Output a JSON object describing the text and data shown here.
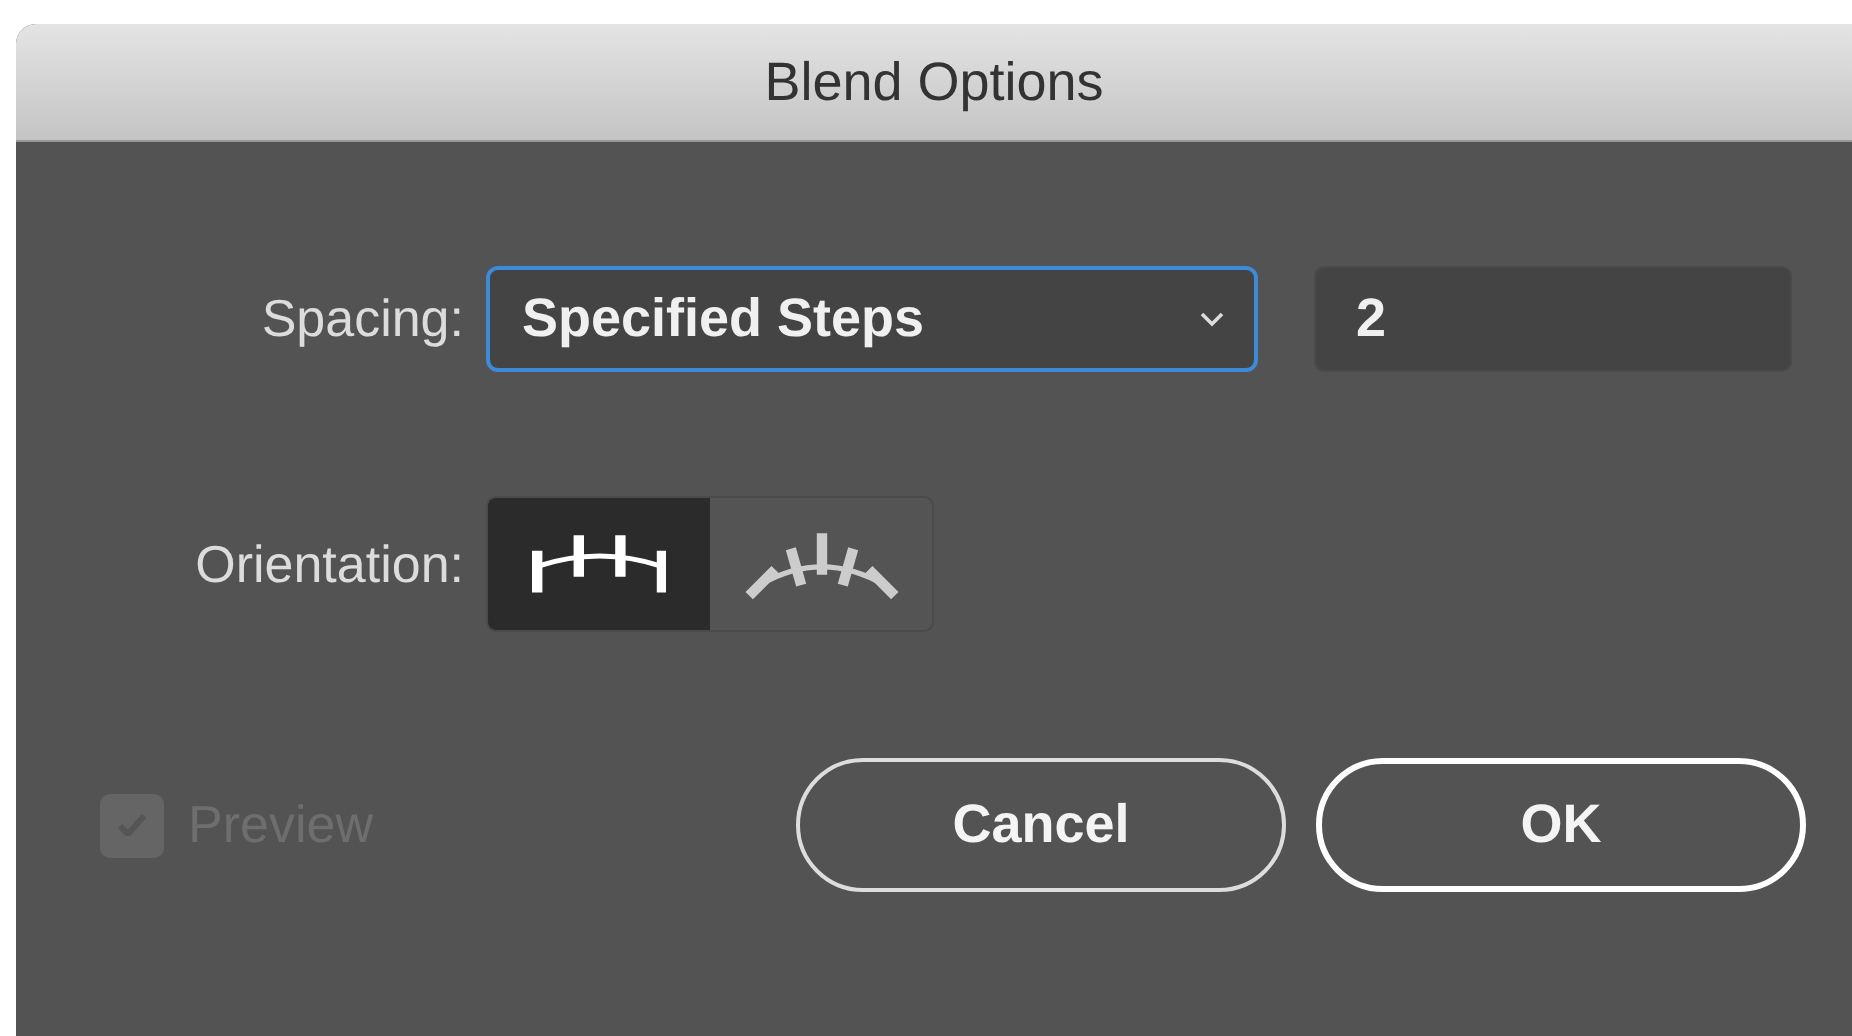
{
  "window": {
    "title": "Blend Options"
  },
  "spacing": {
    "label": "Spacing:",
    "value": "Specified Steps",
    "steps": "2"
  },
  "orientation": {
    "label": "Orientation:",
    "options": [
      {
        "kind": "align-page",
        "selected": true
      },
      {
        "kind": "align-path",
        "selected": false
      }
    ]
  },
  "preview": {
    "label": "Preview",
    "checked": true,
    "disabled": true
  },
  "buttons": [
    {
      "label": "Cancel",
      "default": false
    },
    {
      "label": "OK",
      "default": true
    }
  ]
}
